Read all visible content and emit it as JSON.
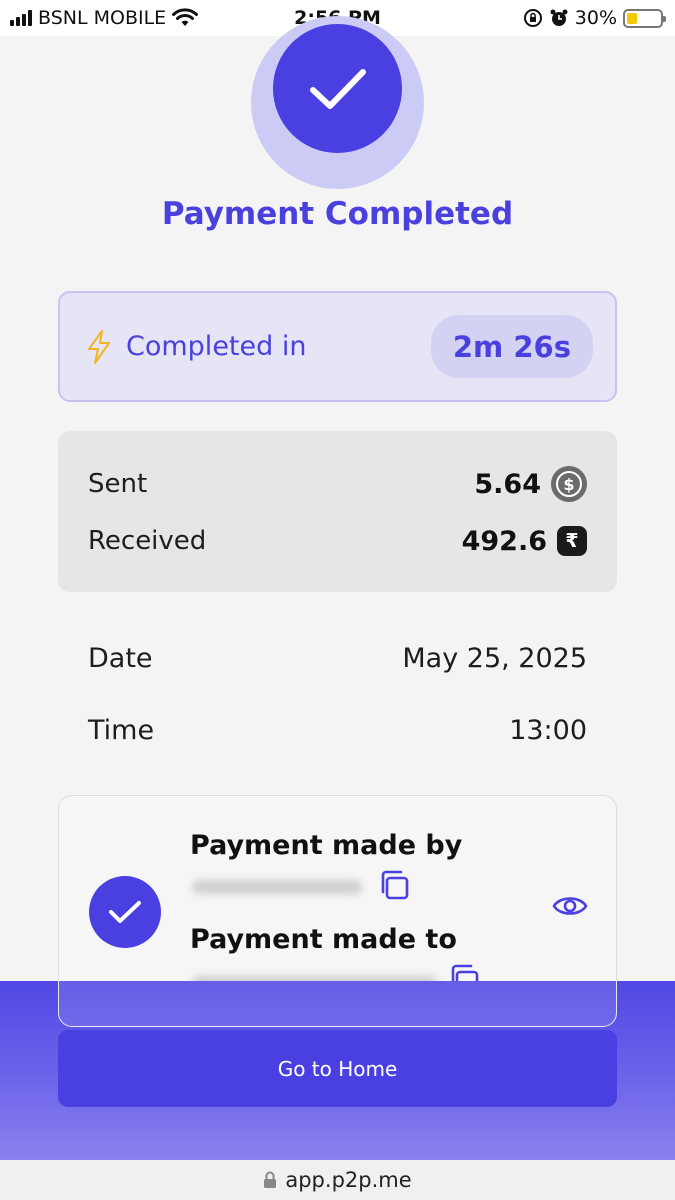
{
  "status_bar": {
    "carrier": "BSNL MOBILE",
    "time": "2:56 PM",
    "battery_percent": "30%",
    "battery_level": 0.3,
    "icons": [
      "signal-icon",
      "wifi-icon",
      "orientation-lock-icon",
      "alarm-icon",
      "battery-icon"
    ]
  },
  "header": {
    "title": "Payment Completed",
    "icon": "checkmark-icon"
  },
  "completion": {
    "icon": "lightning-icon",
    "label": "Completed in",
    "duration": "2m 26s"
  },
  "amounts": {
    "sent_label": "Sent",
    "sent_value": "5.64",
    "sent_icon": "usd-coin-icon",
    "received_label": "Received",
    "received_value": "492.6",
    "received_icon": "rupee-coin-icon"
  },
  "details": {
    "date_label": "Date",
    "date_value": "May 25, 2025",
    "time_label": "Time",
    "time_value": "13:00"
  },
  "parties": {
    "made_by_label": "Payment made by",
    "made_to_label": "Payment made to",
    "icons": [
      "checkmark-icon",
      "copy-icon",
      "eye-icon"
    ]
  },
  "actions": {
    "home_button": "Go to Home"
  },
  "browser": {
    "url": "app.p2p.me",
    "icon": "lock-icon"
  },
  "colors": {
    "accent": "#4a3fe0",
    "accent_light": "#e6e5f6",
    "ring": "#cccbf5",
    "lightning": "#f2b520"
  }
}
